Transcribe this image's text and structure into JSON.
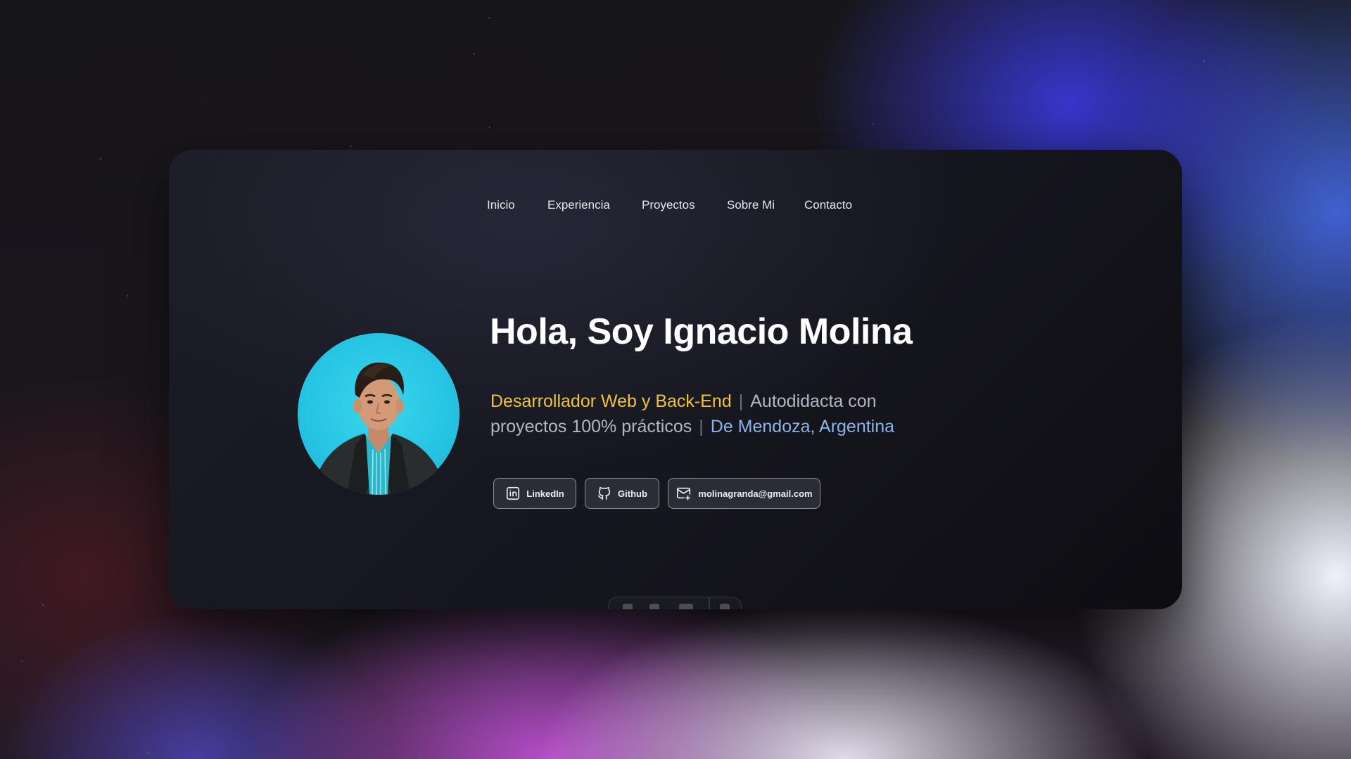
{
  "nav": {
    "items": [
      {
        "label": "Inicio"
      },
      {
        "label": "Experiencia"
      },
      {
        "label": "Proyectos"
      },
      {
        "label": "Sobre Mi"
      },
      {
        "label": "Contacto"
      }
    ]
  },
  "hero": {
    "title": "Hola, Soy Ignacio Molina",
    "role": "Desarrollador Web y Back-End",
    "separator": "|",
    "bio": "Autodidacta con proyectos 100% prácticos",
    "location": "De Mendoza, Argentina"
  },
  "buttons": {
    "linkedin": "LinkedIn",
    "github": "Github",
    "email": "molinagranda@gmail.com"
  },
  "colors": {
    "accent_yellow": "#f1c33a",
    "accent_blue": "#8ab4ea",
    "avatar_bg": "#25c4e2"
  },
  "icons": {
    "linkedin": "linkedin-icon",
    "github": "github-icon",
    "email": "mail-icon"
  }
}
